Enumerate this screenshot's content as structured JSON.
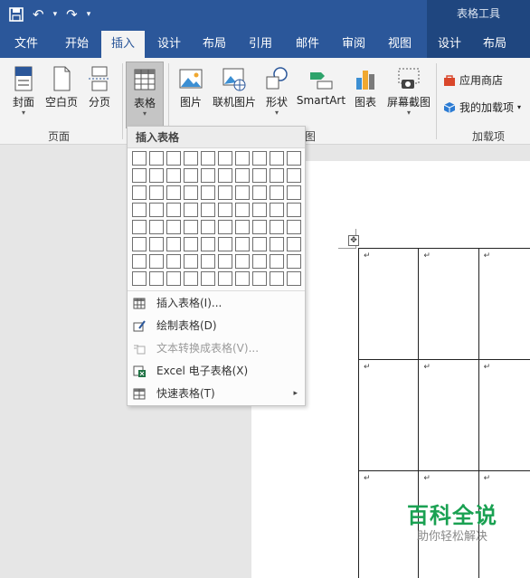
{
  "titlebar": {
    "context_group": "表格工具",
    "undo_glyph": "↶",
    "redo_glyph": "↷",
    "qat_menu_glyph": "▾"
  },
  "tabs": [
    {
      "label": "文件"
    },
    {
      "label": "开始"
    },
    {
      "label": "插入"
    },
    {
      "label": "设计"
    },
    {
      "label": "布局"
    },
    {
      "label": "引用"
    },
    {
      "label": "邮件"
    },
    {
      "label": "审阅"
    },
    {
      "label": "视图"
    },
    {
      "label": "设计"
    },
    {
      "label": "布局"
    }
  ],
  "active_tab": "插入",
  "ribbon": {
    "cover": "封面",
    "blank_page": "空白页",
    "page_break": "分页",
    "table": "表格",
    "picture": "图片",
    "online_picture": "联机图片",
    "shapes": "形状",
    "smartart": "SmartArt",
    "chart": "图表",
    "screenshot": "屏幕截图",
    "app_store": "应用商店",
    "my_addins": "我的加载项",
    "group_pages": "页面",
    "group_illustrations_tail": "图",
    "group_addins": "加载项"
  },
  "dropdown": {
    "header": "插入表格",
    "grid_cols": 10,
    "grid_rows": 8,
    "items": [
      {
        "label": "插入表格(I)...",
        "enabled": true,
        "icon": "insert-table-icon"
      },
      {
        "label": "绘制表格(D)",
        "enabled": true,
        "icon": "draw-table-icon"
      },
      {
        "label": "文本转换成表格(V)...",
        "enabled": false,
        "icon": "convert-text-icon"
      },
      {
        "label": "Excel 电子表格(X)",
        "enabled": true,
        "icon": "excel-icon"
      },
      {
        "label": "快速表格(T)",
        "enabled": true,
        "icon": "quick-table-icon",
        "submenu_glyph": "▸"
      }
    ]
  },
  "document": {
    "anchor_glyph": "✥",
    "paragraph_mark": "↵"
  },
  "watermark": {
    "title": "百科全说",
    "subtitle": "助你轻松解决"
  },
  "colors": {
    "accent": "#2b579a",
    "context": "#1f467f",
    "watermark": "#1aa152"
  }
}
